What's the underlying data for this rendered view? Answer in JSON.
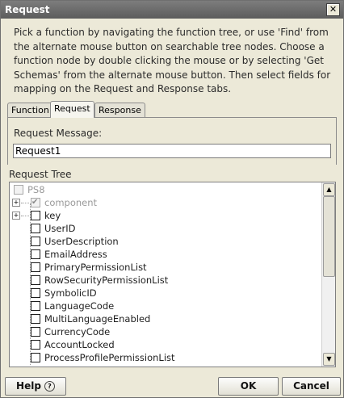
{
  "window": {
    "title": "Request",
    "close_glyph": "✕"
  },
  "instructions": "Pick a function by navigating the function tree, or use 'Find' from the alternate mouse button on searchable tree nodes. Choose a function node by double clicking the mouse or by selecting 'Get Schemas' from the alternate mouse button. Then select fields for mapping on the Request and Response tabs.",
  "tabs": [
    {
      "label": "Function",
      "active": false
    },
    {
      "label": "Request",
      "active": true
    },
    {
      "label": "Response",
      "active": false
    }
  ],
  "request_message": {
    "label": "Request Message:",
    "value": "Request1"
  },
  "request_tree": {
    "label": "Request Tree",
    "nodes": [
      {
        "label": "PS8",
        "checked": false,
        "disabled": true,
        "expandable": false
      },
      {
        "label": "component",
        "checked": true,
        "disabled": true,
        "expandable": true
      },
      {
        "label": "key",
        "checked": false,
        "disabled": false,
        "expandable": true
      },
      {
        "label": "UserID",
        "checked": false,
        "disabled": false,
        "expandable": false
      },
      {
        "label": "UserDescription",
        "checked": false,
        "disabled": false,
        "expandable": false
      },
      {
        "label": "EmailAddress",
        "checked": false,
        "disabled": false,
        "expandable": false
      },
      {
        "label": "PrimaryPermissionList",
        "checked": false,
        "disabled": false,
        "expandable": false
      },
      {
        "label": "RowSecurityPermissionList",
        "checked": false,
        "disabled": false,
        "expandable": false
      },
      {
        "label": "SymbolicID",
        "checked": false,
        "disabled": false,
        "expandable": false
      },
      {
        "label": "LanguageCode",
        "checked": false,
        "disabled": false,
        "expandable": false
      },
      {
        "label": "MultiLanguageEnabled",
        "checked": false,
        "disabled": false,
        "expandable": false
      },
      {
        "label": "CurrencyCode",
        "checked": false,
        "disabled": false,
        "expandable": false
      },
      {
        "label": "AccountLocked",
        "checked": false,
        "disabled": false,
        "expandable": false
      },
      {
        "label": "ProcessProfilePermissionList",
        "checked": false,
        "disabled": false,
        "expandable": false
      }
    ],
    "expand_glyph": "+",
    "scroll_up_glyph": "▲",
    "scroll_down_glyph": "▼"
  },
  "buttons": {
    "help": "Help",
    "help_icon_glyph": "?",
    "ok": "OK",
    "cancel": "Cancel"
  }
}
